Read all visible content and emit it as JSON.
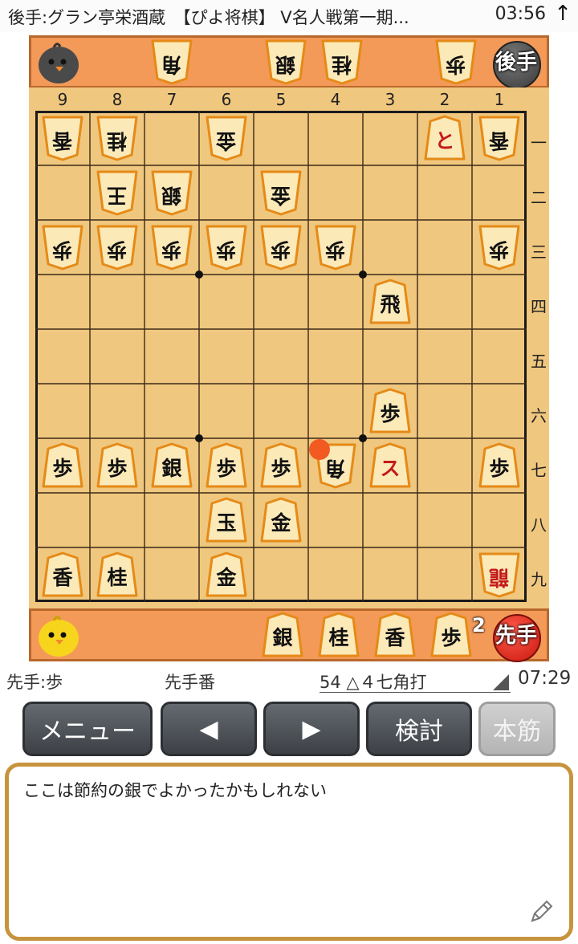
{
  "title_bar": {
    "title": "後手:グラン亭栄酒蔵　【ぴよ将棋】 V名人戦第一期...",
    "clock": "03:56",
    "up_arrow": "↑"
  },
  "gote_stand": {
    "label": "後手",
    "pieces": [
      "角",
      "銀",
      "桂",
      "歩"
    ]
  },
  "sente_stand": {
    "label": "先手",
    "pieces": [
      "銀",
      "桂",
      "香",
      "歩"
    ],
    "pawn_count": "2"
  },
  "board": {
    "files": [
      "9",
      "8",
      "7",
      "6",
      "5",
      "4",
      "3",
      "2",
      "1"
    ],
    "ranks": [
      "一",
      "二",
      "三",
      "四",
      "五",
      "六",
      "七",
      "八",
      "九"
    ],
    "pieces": [
      {
        "file": 9,
        "rank": 1,
        "label": "香",
        "side": "gote"
      },
      {
        "file": 8,
        "rank": 1,
        "label": "桂",
        "side": "gote"
      },
      {
        "file": 6,
        "rank": 1,
        "label": "金",
        "side": "gote"
      },
      {
        "file": 2,
        "rank": 1,
        "label": "と",
        "side": "sente",
        "promoted": true
      },
      {
        "file": 1,
        "rank": 1,
        "label": "香",
        "side": "gote"
      },
      {
        "file": 8,
        "rank": 2,
        "label": "王",
        "side": "gote"
      },
      {
        "file": 7,
        "rank": 2,
        "label": "銀",
        "side": "gote"
      },
      {
        "file": 5,
        "rank": 2,
        "label": "金",
        "side": "gote"
      },
      {
        "file": 9,
        "rank": 3,
        "label": "歩",
        "side": "gote"
      },
      {
        "file": 8,
        "rank": 3,
        "label": "歩",
        "side": "gote"
      },
      {
        "file": 7,
        "rank": 3,
        "label": "歩",
        "side": "gote"
      },
      {
        "file": 6,
        "rank": 3,
        "label": "歩",
        "side": "gote"
      },
      {
        "file": 5,
        "rank": 3,
        "label": "歩",
        "side": "gote"
      },
      {
        "file": 4,
        "rank": 3,
        "label": "歩",
        "side": "gote"
      },
      {
        "file": 1,
        "rank": 3,
        "label": "歩",
        "side": "gote"
      },
      {
        "file": 3,
        "rank": 4,
        "label": "飛",
        "side": "sente"
      },
      {
        "file": 3,
        "rank": 6,
        "label": "歩",
        "side": "sente"
      },
      {
        "file": 9,
        "rank": 7,
        "label": "歩",
        "side": "sente"
      },
      {
        "file": 8,
        "rank": 7,
        "label": "歩",
        "side": "sente"
      },
      {
        "file": 7,
        "rank": 7,
        "label": "銀",
        "side": "sente"
      },
      {
        "file": 6,
        "rank": 7,
        "label": "歩",
        "side": "sente"
      },
      {
        "file": 5,
        "rank": 7,
        "label": "歩",
        "side": "sente"
      },
      {
        "file": 4,
        "rank": 7,
        "label": "角",
        "side": "gote"
      },
      {
        "file": 3,
        "rank": 7,
        "label": "ス",
        "side": "sente",
        "promoted": true
      },
      {
        "file": 1,
        "rank": 7,
        "label": "歩",
        "side": "sente"
      },
      {
        "file": 6,
        "rank": 8,
        "label": "玉",
        "side": "sente"
      },
      {
        "file": 5,
        "rank": 8,
        "label": "金",
        "side": "sente"
      },
      {
        "file": 9,
        "rank": 9,
        "label": "香",
        "side": "sente"
      },
      {
        "file": 8,
        "rank": 9,
        "label": "桂",
        "side": "sente"
      },
      {
        "file": 6,
        "rank": 9,
        "label": "金",
        "side": "sente"
      },
      {
        "file": 1,
        "rank": 9,
        "label": "龍",
        "side": "gote",
        "promoted": true
      }
    ]
  },
  "status": {
    "sente_hand": "先手:歩",
    "turn": "先手番",
    "move": "54 △４七角打",
    "time": "07:29"
  },
  "buttons": {
    "menu": "メニュー",
    "prev": "◀",
    "next": "▶",
    "analyze": "検討",
    "mainline": "本筋"
  },
  "comment": {
    "text": "ここは節約の銀でよかったかもしれない"
  },
  "colors": {
    "stand": "#f39a58",
    "board": "#f0c77e",
    "piece": "#fbe9b8",
    "piece_border": "#e58a17",
    "last_move": "#f25a22",
    "comment_border": "#c7943e"
  }
}
